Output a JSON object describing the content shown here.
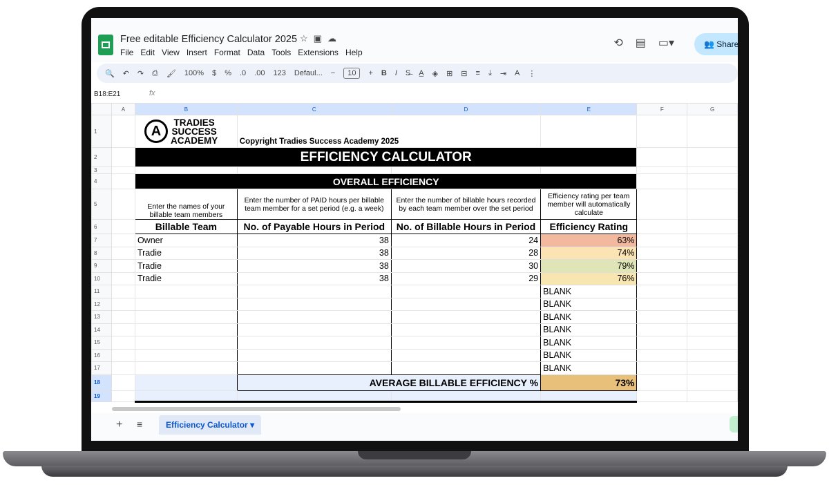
{
  "app": {
    "doc_title": "Free editable Efficiency Calculator 2025",
    "menu": [
      "File",
      "Edit",
      "View",
      "Insert",
      "Format",
      "Data",
      "Tools",
      "Extensions",
      "Help"
    ],
    "share_label": "Share"
  },
  "toolbar": {
    "zoom": "100%",
    "currency": "$",
    "percent": "%",
    "dec_decrease": ".0",
    "dec_increase": ".00",
    "number_format": "123",
    "font": "Defaul...",
    "font_size": "10",
    "bold": "B",
    "italic": "I"
  },
  "formula_bar": {
    "name_box": "B18:E21",
    "fx": "fx"
  },
  "columns": [
    "A",
    "B",
    "C",
    "D",
    "E",
    "F",
    "G"
  ],
  "rows": [
    "1",
    "2",
    "3",
    "4",
    "5",
    "6",
    "7",
    "8",
    "9",
    "10",
    "11",
    "12",
    "13",
    "14",
    "15",
    "16",
    "17",
    "18",
    "19"
  ],
  "sheet": {
    "logo_letter": "A",
    "logo_line1": "TRADIES",
    "logo_line2": "SUCCESS",
    "logo_line3": "ACADEMY",
    "copyright": "Copyright Tradies Success Academy 2025",
    "main_title": "EFFICIENCY CALCULATOR",
    "section_title": "OVERALL EFFICIENCY",
    "instructions": {
      "b": "Enter the names of your billable team members",
      "c": "Enter the number of PAID hours per billable team member for a set period (e.g. a week)",
      "d": "Enter the number of billable hours recorded by each team member over the set period",
      "e": "Efficiency rating per team member will automatically calculate"
    },
    "headers": {
      "b": "Billable Team",
      "c": "No. of Payable Hours in Period",
      "d": "No. of Billable Hours in Period",
      "e": "Efficiency Rating"
    },
    "team": [
      {
        "name": "Owner",
        "payable": "38",
        "billable": "24",
        "rating": "63%",
        "color": "#f3b99f"
      },
      {
        "name": "Tradie",
        "payable": "38",
        "billable": "28",
        "rating": "74%",
        "color": "#fbe3b3"
      },
      {
        "name": "Tradie",
        "payable": "38",
        "billable": "30",
        "rating": "79%",
        "color": "#dfe5b6"
      },
      {
        "name": "Tradie",
        "payable": "38",
        "billable": "29",
        "rating": "76%",
        "color": "#f7e6b0"
      }
    ],
    "blank_label": "BLANK",
    "average_label": "AVERAGE BILLABLE EFFICIENCY %",
    "average_value": "73%"
  },
  "tabs": {
    "add": "+",
    "list": "≡",
    "active": "Efficiency Calculator"
  }
}
